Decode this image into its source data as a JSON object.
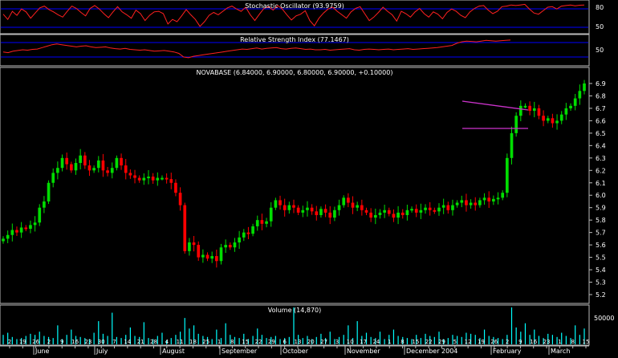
{
  "panels": {
    "stochastic": {
      "title": "Stochastic Oscillator (93.9759)",
      "ticks": [
        "80",
        "50"
      ]
    },
    "rsi": {
      "title": "Relative Strength Index (77.1467)",
      "ticks": [
        "50"
      ]
    },
    "price": {
      "title": "NOVABASE (6.84000, 6.90000, 6.80000, 6.90000, +0.10000)",
      "ticks": [
        "6.9",
        "6.8",
        "6.7",
        "6.6",
        "6.5",
        "6.4",
        "6.3",
        "6.2",
        "6.1",
        "6.0",
        "5.9",
        "5.8",
        "5.7",
        "5.6",
        "5.5",
        "5.4",
        "5.3",
        "5.2"
      ]
    },
    "volume": {
      "title": "Volume (14,870)",
      "ticks": [
        "50000"
      ]
    }
  },
  "x_axis": {
    "day_labels": [
      "2",
      "19",
      "26",
      "2",
      "9",
      "16",
      "23",
      "30",
      "7",
      "14",
      "21",
      "28",
      "4",
      "11",
      "18",
      "25",
      "1",
      "8",
      "15",
      "22",
      "29",
      "6",
      "13",
      "20",
      "27",
      "3",
      "10",
      "17",
      "24",
      "1",
      "8",
      "15",
      "22",
      "29",
      "5",
      "12",
      "19",
      "26",
      "2",
      "9",
      "16",
      "23",
      "1",
      "8",
      "15"
    ],
    "month_labels": [
      "June",
      "July",
      "August",
      "September",
      "October",
      "November",
      "December 2004",
      "February",
      "March"
    ]
  },
  "colors": {
    "up": "#00dd00",
    "down": "#ff0000",
    "indicator_line": "#ff2020",
    "reference_line": "#0000ff",
    "trendline": "#cc33cc",
    "volume": "#00ffff",
    "grid": "#bbbbbb",
    "text": "#ffffff"
  },
  "chart_data": {
    "type": "candlestick",
    "title": "NOVABASE (6.84000, 6.90000, 6.80000, 6.90000, +0.10000)",
    "ylim": [
      5.2,
      6.9
    ],
    "last_bar": {
      "open": 6.84,
      "high": 6.9,
      "low": 6.8,
      "close": 6.9,
      "change": 0.1
    },
    "indicators": {
      "stochastic_last": 93.9759,
      "rsi_last": 77.1467,
      "volume_last": 14870
    },
    "closes": [
      5.65,
      5.68,
      5.72,
      5.7,
      5.74,
      5.73,
      5.76,
      5.78,
      5.9,
      5.95,
      6.1,
      6.18,
      6.22,
      6.3,
      6.25,
      6.2,
      6.26,
      6.32,
      6.24,
      6.2,
      6.22,
      6.28,
      6.2,
      6.18,
      6.22,
      6.3,
      6.24,
      6.18,
      6.16,
      6.14,
      6.12,
      6.14,
      6.15,
      6.12,
      6.14,
      6.14,
      6.13,
      6.1,
      6.02,
      5.92,
      5.55,
      5.62,
      5.6,
      5.5,
      5.52,
      5.49,
      5.51,
      5.47,
      5.58,
      5.6,
      5.58,
      5.62,
      5.66,
      5.7,
      5.69,
      5.75,
      5.8,
      5.77,
      5.79,
      5.9,
      5.96,
      5.92,
      5.88,
      5.92,
      5.9,
      5.86,
      5.88,
      5.9,
      5.87,
      5.84,
      5.89,
      5.86,
      5.82,
      5.88,
      5.92,
      5.98,
      5.94,
      5.9,
      5.92,
      5.88,
      5.86,
      5.82,
      5.84,
      5.86,
      5.88,
      5.85,
      5.82,
      5.86,
      5.84,
      5.88,
      5.89,
      5.86,
      5.88,
      5.9,
      5.88,
      5.87,
      5.9,
      5.92,
      5.88,
      5.92,
      5.94,
      5.96,
      5.92,
      5.94,
      5.92,
      5.96,
      5.98,
      5.95,
      5.97,
      5.98,
      6.02,
      6.3,
      6.5,
      6.64,
      6.72,
      6.72,
      6.68,
      6.7,
      6.64,
      6.6,
      6.62,
      6.58,
      6.6,
      6.65,
      6.7,
      6.72,
      6.78,
      6.84,
      6.9
    ],
    "volumes": [
      9,
      11,
      7,
      5,
      6,
      8,
      10,
      9,
      12,
      8,
      7,
      6,
      18,
      5,
      9,
      14,
      8,
      7,
      6,
      5,
      11,
      22,
      10,
      8,
      30,
      7,
      6,
      9,
      16,
      8,
      7,
      21,
      6,
      5,
      8,
      11,
      4,
      6,
      9,
      12,
      25,
      15,
      18,
      10,
      8,
      7,
      5,
      14,
      6,
      20,
      9,
      7,
      6,
      10,
      5,
      8,
      15,
      9,
      6,
      7,
      8,
      5,
      6,
      7,
      35,
      9,
      6,
      8,
      5,
      7,
      10,
      6,
      12,
      5,
      7,
      9,
      18,
      6,
      22,
      8,
      11,
      7,
      6,
      12,
      5,
      9,
      14,
      8,
      7,
      6,
      5,
      9,
      6,
      10,
      8,
      7,
      12,
      5,
      6,
      9,
      8,
      7,
      11,
      10,
      9,
      6,
      14,
      8,
      7,
      6,
      5,
      9,
      35,
      16,
      12,
      20,
      9,
      14,
      8,
      6,
      10,
      9,
      7,
      11,
      8,
      6,
      18,
      9,
      15
    ],
    "stochastic": [
      62,
      44,
      72,
      58,
      80,
      70,
      48,
      66,
      84,
      90,
      78,
      70,
      60,
      52,
      72,
      90,
      82,
      68,
      56,
      82,
      92,
      80,
      64,
      50,
      70,
      88,
      70,
      60,
      48,
      76,
      64,
      40,
      58,
      70,
      72,
      64,
      28,
      44,
      36,
      56,
      78,
      60,
      44,
      20,
      36,
      58,
      68,
      60,
      72,
      84,
      90,
      80,
      72,
      86,
      60,
      40,
      62,
      82,
      88,
      76,
      92,
      80,
      60,
      42,
      56,
      62,
      74,
      40,
      22,
      48,
      66,
      80,
      86,
      72,
      60,
      48,
      70,
      82,
      88,
      64,
      40,
      52,
      68,
      86,
      72,
      60,
      38,
      72,
      64,
      52,
      70,
      82,
      64,
      52,
      70,
      62,
      46,
      68,
      80,
      72,
      58,
      50,
      70,
      82,
      90,
      92,
      76,
      64,
      72,
      88,
      90,
      94,
      92,
      94,
      96,
      80,
      66,
      62,
      74,
      86,
      88,
      80,
      90,
      92,
      94,
      91,
      93,
      94
    ],
    "rsi": [
      44,
      42,
      46,
      48,
      50,
      49,
      51,
      52,
      56,
      60,
      64,
      66,
      64,
      62,
      60,
      58,
      60,
      61,
      58,
      56,
      57,
      58,
      55,
      53,
      52,
      54,
      51,
      50,
      49,
      50,
      48,
      46,
      47,
      48,
      46,
      44,
      40,
      30,
      28,
      32,
      34,
      36,
      38,
      40,
      42,
      44,
      46,
      48,
      50,
      52,
      51,
      53,
      55,
      52,
      54,
      55,
      56,
      53,
      52,
      54,
      55,
      53,
      51,
      52,
      50,
      50,
      51,
      49,
      50,
      51,
      52,
      53,
      50,
      49,
      51,
      52,
      51,
      50,
      51,
      52,
      50,
      51,
      52,
      53,
      51,
      52,
      53,
      54,
      55,
      56,
      58,
      60,
      62,
      68,
      72,
      74,
      73,
      72,
      74,
      76,
      75,
      74,
      75,
      76,
      77
    ]
  }
}
